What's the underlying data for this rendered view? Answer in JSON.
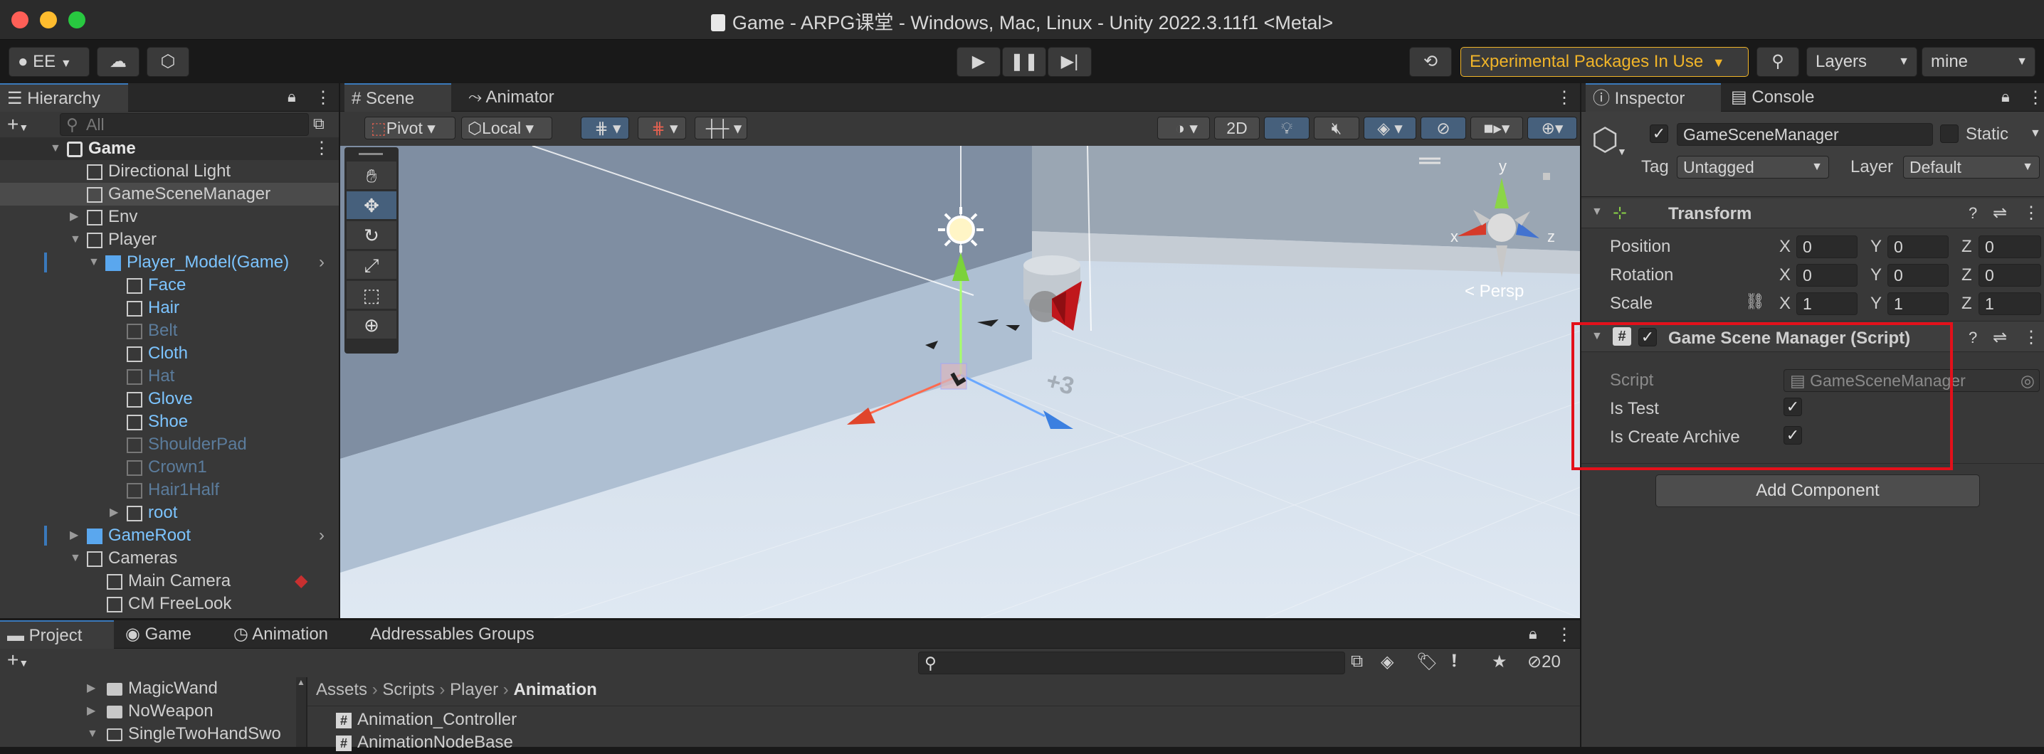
{
  "window": {
    "title": "Game - ARPG课堂 - Windows, Mac, Linux - Unity 2022.3.11f1 <Metal>"
  },
  "toolbar": {
    "account": "EE",
    "experimental": "Experimental Packages In Use",
    "layers": "Layers",
    "layout": "mine"
  },
  "hierarchy": {
    "tab": "Hierarchy",
    "search_placeholder": "All",
    "scene": "Game",
    "items": [
      {
        "label": "Directional Light"
      },
      {
        "label": "GameSceneManager"
      },
      {
        "label": "Env"
      },
      {
        "label": "Player"
      },
      {
        "label": "Player_Model(Game)"
      },
      {
        "label": "Face"
      },
      {
        "label": "Hair"
      },
      {
        "label": "Belt"
      },
      {
        "label": "Cloth"
      },
      {
        "label": "Hat"
      },
      {
        "label": "Glove"
      },
      {
        "label": "Shoe"
      },
      {
        "label": "ShoulderPad"
      },
      {
        "label": "Crown1"
      },
      {
        "label": "Hair1Half"
      },
      {
        "label": "root"
      },
      {
        "label": "GameRoot"
      },
      {
        "label": "Cameras"
      },
      {
        "label": "Main Camera"
      },
      {
        "label": "CM FreeLook"
      }
    ]
  },
  "scene": {
    "tabs": [
      "Scene",
      "Animator"
    ],
    "pivot": "Pivot",
    "local": "Local",
    "mode_2d": "2D",
    "persp": "< Persp",
    "gizmo_x": "x",
    "gizmo_y": "y",
    "gizmo_z": "z"
  },
  "inspector": {
    "tabs": [
      "Inspector",
      "Console"
    ],
    "object_name": "GameSceneManager",
    "static_label": "Static",
    "tag_label": "Tag",
    "tag_value": "Untagged",
    "layer_label": "Layer",
    "layer_value": "Default",
    "transform": {
      "title": "Transform",
      "rows": [
        {
          "label": "Position",
          "x": "0",
          "y": "0",
          "z": "0"
        },
        {
          "label": "Rotation",
          "x": "0",
          "y": "0",
          "z": "0"
        },
        {
          "label": "Scale",
          "x": "1",
          "y": "1",
          "z": "1"
        }
      ],
      "axis_x": "X",
      "axis_y": "Y",
      "axis_z": "Z"
    },
    "component": {
      "title": "Game Scene Manager (Script)",
      "script_label": "Script",
      "script_value": "GameSceneManager",
      "is_test_label": "Is Test",
      "is_create_archive_label": "Is Create Archive"
    },
    "add_component": "Add Component"
  },
  "project": {
    "tabs": [
      "Project",
      "Game",
      "Animation",
      "Addressables Groups"
    ],
    "folders": [
      "MagicWand",
      "NoWeapon",
      "SingleTwoHandSwo"
    ],
    "breadcrumb": [
      "Assets",
      "Scripts",
      "Player",
      "Animation"
    ],
    "files": [
      "Animation_Controller",
      "AnimationNodeBase"
    ],
    "hidden_count": "20"
  },
  "colors": {
    "accent_blue": "#3a79bb",
    "prefab_blue": "#7cc4ff",
    "highlight_red": "#e3101a",
    "experimental_yellow": "#f0b429"
  }
}
